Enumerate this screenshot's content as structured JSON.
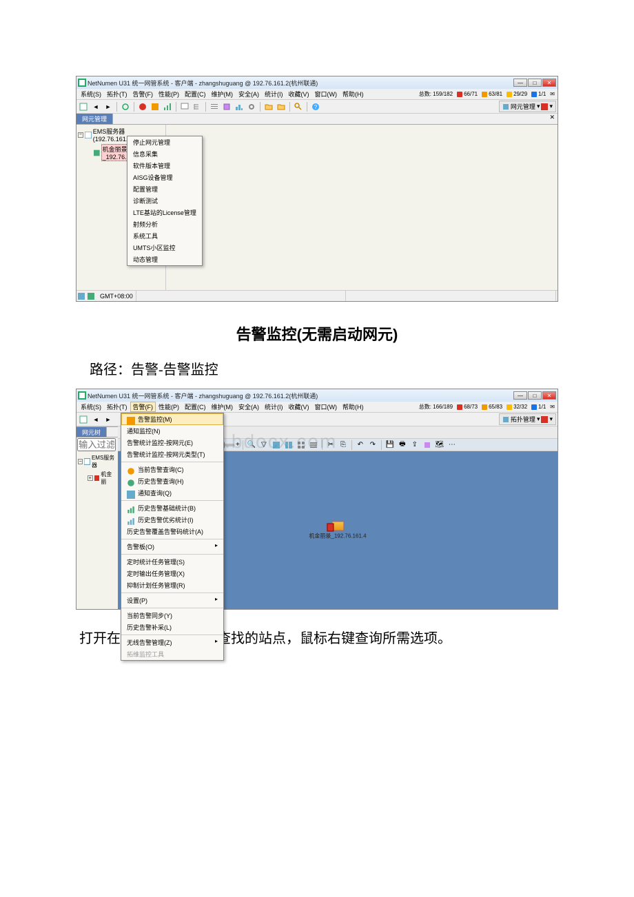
{
  "doc": {
    "heading": "告警监控(无需启动网元)",
    "path_text": "路径：告警-告警监控",
    "conclusion": "打开在网元树中搜索需查找的站点，鼠标右键查询所需选项。"
  },
  "watermark": "www.bdocx.com",
  "screenshot1": {
    "title": "NetNumen U31 统一网管系统 - 客户端 - zhangshuguang @ 192.76.161.2(杭州联通)",
    "menubar": [
      "系统(S)",
      "拓扑(T)",
      "告警(F)",
      "性能(P)",
      "配置(C)",
      "维护(M)",
      "安全(A)",
      "统计(I)",
      "收藏(V)",
      "窗口(W)",
      "帮助(H)"
    ],
    "status": {
      "total_label": "总数: 159/182",
      "c1": "66/71",
      "c2": "63/81",
      "c3": "29/29",
      "c4": "1/1"
    },
    "right_sel": "网元管理",
    "tab": "网元管理",
    "tree": {
      "root": "EMS服务器(192.76.161.2)",
      "child": "机金丽景_192.76.161.4..."
    },
    "context_menu": [
      "停止网元管理",
      "信息采集",
      "软件版本管理",
      "AISG设备管理",
      "配置管理",
      "诊断测试",
      "LTE基站的License管理",
      "射频分析",
      "系统工具",
      "UMTS小区监控",
      "动态管理"
    ],
    "statusbar": "GMT+08:00"
  },
  "screenshot2": {
    "title": "NetNumen U31 统一网管系统 - 客户端 - zhangshuguang @ 192.76.161.2(杭州联通)",
    "menubar": [
      "系统(S)",
      "拓扑(T)",
      "告警(F)",
      "性能(P)",
      "配置(C)",
      "维护(M)",
      "安全(A)",
      "统计(I)",
      "收藏(V)",
      "窗口(W)",
      "帮助(H)"
    ],
    "menubar_hl_index": 2,
    "status": {
      "total_label": "总数: 166/189",
      "c1": "68/73",
      "c2": "65/83",
      "c3": "32/32",
      "c4": "1/1"
    },
    "right_sel": "拓扑管理",
    "tab": "网元树",
    "filter_placeholder": "输入过滤条件",
    "tree": {
      "root": "EMS服务器",
      "child": "机金丽"
    },
    "dropdown_menu": [
      {
        "label": "告警监控(M)",
        "hl": true,
        "icon": true
      },
      {
        "label": "通知监控(N)"
      },
      {
        "label": "告警统计监控-按网元(E)"
      },
      {
        "label": "告警统计监控-按网元类型(T)"
      },
      {
        "sep": true
      },
      {
        "label": "当前告警查询(C)",
        "icon": true
      },
      {
        "label": "历史告警查询(H)",
        "icon": true
      },
      {
        "label": "通知查询(Q)",
        "icon": true
      },
      {
        "sep": true
      },
      {
        "label": "历史告警基础统计(B)",
        "icon": true
      },
      {
        "label": "历史告警优劣统计(I)",
        "icon": true
      },
      {
        "label": "历史告警覆盖告警码统计(A)"
      },
      {
        "sep": true
      },
      {
        "label": "告警板(O)",
        "arrow": true
      },
      {
        "sep": true
      },
      {
        "label": "定时统计任务管理(S)"
      },
      {
        "label": "定时输出任务管理(X)"
      },
      {
        "label": "抑制计划任务管理(R)"
      },
      {
        "sep": true
      },
      {
        "label": "设置(P)",
        "arrow": true
      },
      {
        "sep": true
      },
      {
        "label": "当前告警同步(Y)"
      },
      {
        "label": "历史告警补采(L)"
      },
      {
        "sep": true
      },
      {
        "label": "无线告警管理(Z)",
        "arrow": true
      },
      {
        "label": "拓维监控工具",
        "dis": true
      }
    ],
    "topo_label": "机金丽景_192.76.161.4"
  }
}
